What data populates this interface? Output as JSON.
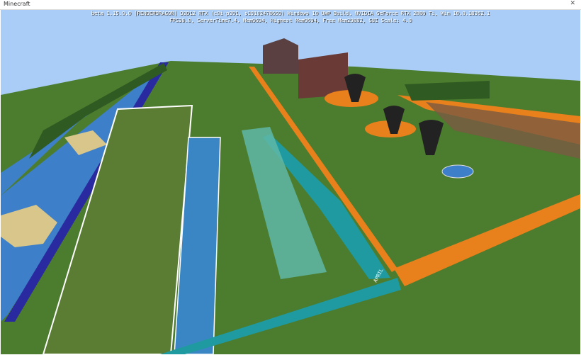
{
  "window": {
    "title": "Minecraft",
    "close_icon": "close-icon"
  },
  "debug": {
    "line1": "beta 1.15.0.0 [RENDERDRAGON] D3D12 RTX  (c0i-p391, s19102478659) Windows 10 UWP Build, NVIDIA GeForce RTX 2080 Ti, Win 10.0.18362.1",
    "line2": "FPS30.8, ServerTime7.4, Mem9694, Highest Mem9694, Free Mem29882, GUI Scale: 4.0"
  },
  "world": {
    "sign_text": "APRIL",
    "colors": {
      "sky": "#a9cdf7",
      "grass": "#4a7a2c",
      "water": "#3d7fc8",
      "orange": "#e8801c",
      "teal": "#1e9aa0",
      "border": "#2a2aa0"
    }
  }
}
